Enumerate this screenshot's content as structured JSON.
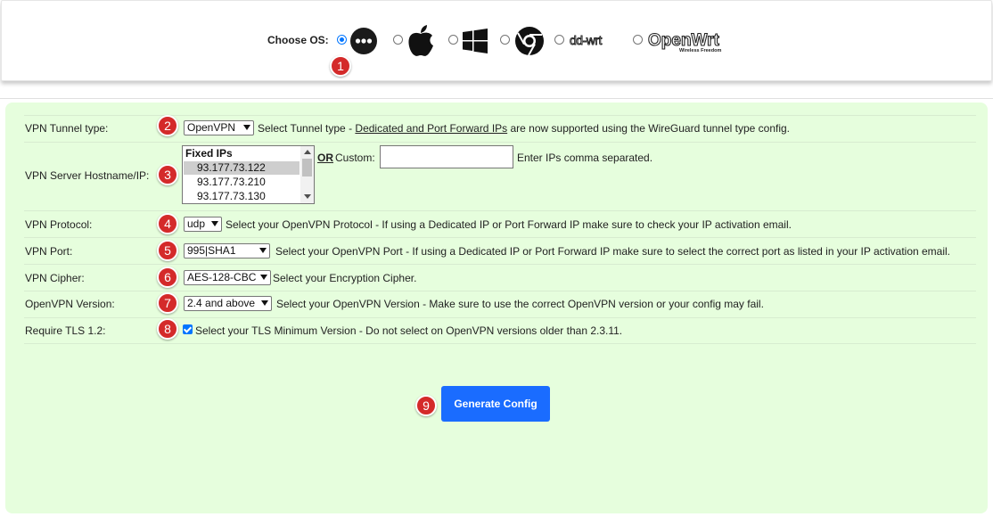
{
  "os_chooser": {
    "label": "Choose OS:",
    "options": [
      {
        "name": "other",
        "icon": "ellipsis-circle-icon",
        "selected": true
      },
      {
        "name": "apple",
        "icon": "apple-icon",
        "selected": false
      },
      {
        "name": "windows",
        "icon": "windows-icon",
        "selected": false
      },
      {
        "name": "chrome",
        "icon": "chrome-icon",
        "selected": false
      },
      {
        "name": "dd-wrt",
        "icon": "dd-wrt-logo-icon",
        "selected": false
      },
      {
        "name": "openwrt",
        "icon": "openwrt-logo-icon",
        "selected": false
      }
    ],
    "ddwrt_logo_text": "dd-wrt",
    "openwrt_logo_text": "OpenWrt",
    "openwrt_tagline": "Wireless Freedom"
  },
  "steps": [
    "1",
    "2",
    "3",
    "4",
    "5",
    "6",
    "7",
    "8",
    "9"
  ],
  "form": {
    "tunnel_type": {
      "label": "VPN Tunnel type:",
      "value": "OpenVPN",
      "desc_prefix": "Select Tunnel type - ",
      "desc_link": "Dedicated and Port Forward IPs",
      "desc_suffix": " are now supported using the WireGuard tunnel type config."
    },
    "server": {
      "label": "VPN Server Hostname/IP:",
      "group": "Fixed IPs",
      "ips": [
        "93.177.73.122",
        "93.177.73.210",
        "93.177.73.130"
      ],
      "or_label": "OR",
      "custom_label": "Custom:",
      "custom_value": "",
      "custom_hint": "Enter IPs comma separated."
    },
    "protocol": {
      "label": "VPN Protocol:",
      "value": "udp",
      "desc": "Select your OpenVPN Protocol - If using a Dedicated IP or Port Forward IP make sure to check your IP activation email."
    },
    "port": {
      "label": "VPN Port:",
      "value": "995|SHA1",
      "desc": "Select your OpenVPN Port - If using a Dedicated IP or Port Forward IP make sure to select the correct port as listed in your IP activation email."
    },
    "cipher": {
      "label": "VPN Cipher:",
      "value": "AES-128-CBC",
      "desc": "Select your Encryption Cipher."
    },
    "version": {
      "label": "OpenVPN Version:",
      "value": "2.4 and above",
      "desc": "Select your OpenVPN Version - Make sure to use the correct OpenVPN version or your config may fail."
    },
    "tls": {
      "label": "Require TLS 1.2:",
      "checked": true,
      "desc": "Select your TLS Minimum Version - Do not select on OpenVPN versions older than 2.3.11."
    }
  },
  "generate_button": "Generate Config",
  "colors": {
    "panel_bg": "#e6fedd",
    "accent": "#1a6cff",
    "badge": "#d42a2a"
  }
}
